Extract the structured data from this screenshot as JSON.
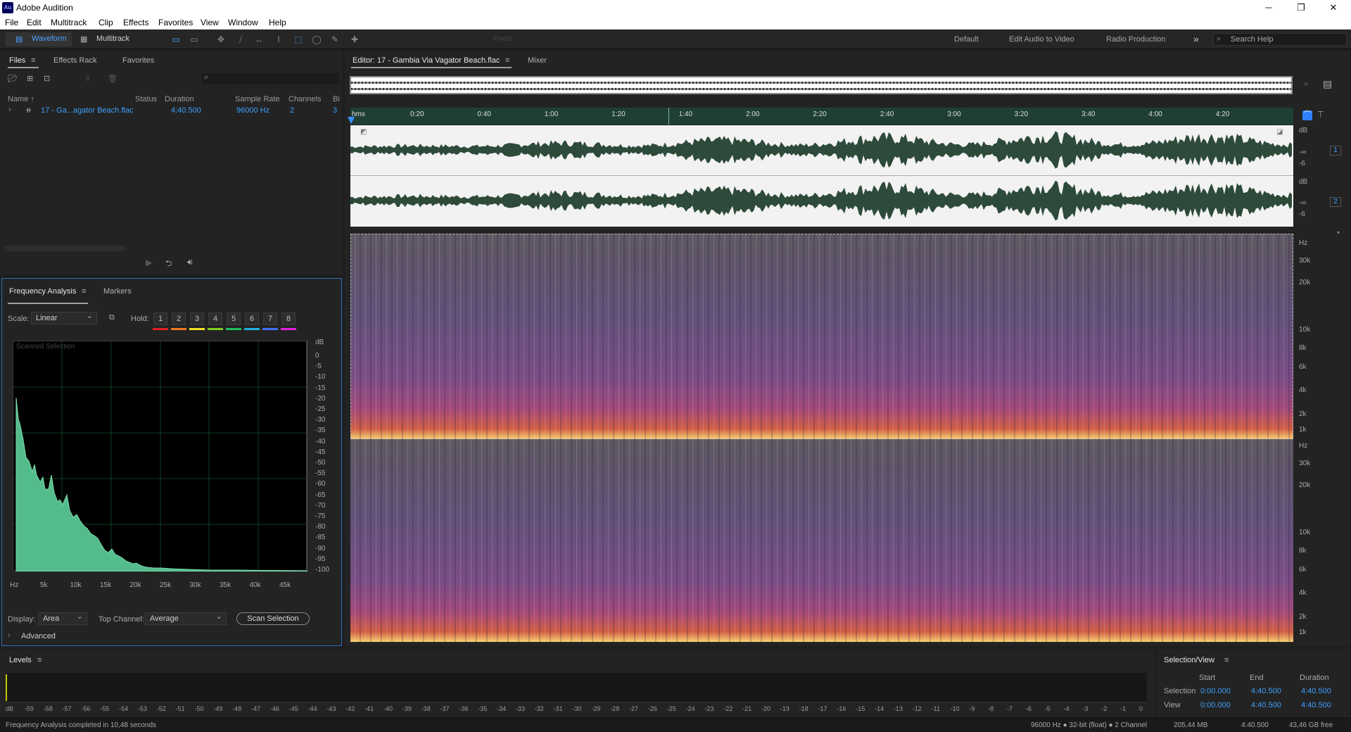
{
  "app": {
    "title": "Adobe Audition",
    "logo": "Au",
    "min": "─",
    "max": "❐",
    "close": "✕"
  },
  "menu": [
    "File",
    "Edit",
    "Multitrack",
    "Clip",
    "Effects",
    "Favorites",
    "View",
    "Window",
    "Help"
  ],
  "toolbar": {
    "waveform": "Waveform",
    "multitrack": "Multitrack",
    "invert": "Invert",
    "ws": [
      "Default",
      "Edit Audio to Video",
      "Radio Production"
    ],
    "more": "»",
    "search_placeholder": "Search Help"
  },
  "files": {
    "tabs": [
      "Files",
      "Effects Rack",
      "Favorites"
    ],
    "cols": [
      "Name ↑",
      "Status",
      "Duration",
      "Sample Rate",
      "Channels",
      "Bi"
    ],
    "row": {
      "name": "17 - Ga...agator Beach.flac",
      "duration": "4:40.500",
      "rate": "96000 Hz",
      "channels": "2",
      "bits": "3"
    }
  },
  "fa": {
    "tabs": [
      "Frequency Analysis",
      "Markers"
    ],
    "scale_label": "Scale:",
    "scale": "Linear",
    "hold_label": "Hold:",
    "hold": [
      "1",
      "2",
      "3",
      "4",
      "5",
      "6",
      "7",
      "8"
    ],
    "hold_colors": [
      "#e02020",
      "#f07820",
      "#f0e020",
      "#80d020",
      "#20c060",
      "#20b0e0",
      "#4070ff",
      "#e020e0"
    ],
    "scanned": "Scanned Selection",
    "db_ticks": [
      "dB",
      "0",
      "-5",
      "-10",
      "-15",
      "-20",
      "-25",
      "-30",
      "-35",
      "-40",
      "-45",
      "-50",
      "-55",
      "-60",
      "-65",
      "-70",
      "-75",
      "-80",
      "-85",
      "-90",
      "-95",
      "-100"
    ],
    "hz_ticks": [
      "Hz",
      "5k",
      "10k",
      "15k",
      "20k",
      "25k",
      "30k",
      "35k",
      "40k",
      "45k"
    ],
    "display_label": "Display:",
    "display": "Area",
    "top_channel_label": "Top Channel:",
    "top_channel": "Average",
    "scan_btn": "Scan Selection",
    "advanced": "Advanced"
  },
  "editor": {
    "tab": "Editor: 17 - Gambia Via Vagator Beach.flac",
    "mixer": "Mixer",
    "ruler": [
      "hms",
      "0:20",
      "0:40",
      "1:00",
      "1:20",
      "1:40",
      "2:00",
      "2:20",
      "2:40",
      "3:00",
      "3:20",
      "3:40",
      "4:00",
      "4:20"
    ],
    "wave_scale": [
      "dB",
      "-∞",
      "-6"
    ],
    "ch": [
      "1",
      "2"
    ],
    "spec_top": [
      "Hz",
      "30k",
      "20k",
      "10k",
      "8k",
      "6k",
      "4k",
      "2k",
      "1k"
    ]
  },
  "levels": {
    "title": "Levels",
    "ticks": [
      "dB",
      "-59",
      "-58",
      "-57",
      "-56",
      "-55",
      "-54",
      "-53",
      "-52",
      "-51",
      "-50",
      "-49",
      "-48",
      "-47",
      "-46",
      "-45",
      "-44",
      "-43",
      "-42",
      "-41",
      "-40",
      "-39",
      "-38",
      "-37",
      "-36",
      "-35",
      "-34",
      "-33",
      "-32",
      "-31",
      "-30",
      "-29",
      "-28",
      "-27",
      "-26",
      "-25",
      "-24",
      "-23",
      "-22",
      "-21",
      "-20",
      "-19",
      "-18",
      "-17",
      "-16",
      "-15",
      "-14",
      "-13",
      "-12",
      "-11",
      "-10",
      "-9",
      "-8",
      "-7",
      "-6",
      "-5",
      "-4",
      "-3",
      "-2",
      "-1",
      "0"
    ]
  },
  "selview": {
    "title": "Selection/View",
    "hdr": [
      "Start",
      "End",
      "Duration"
    ],
    "sel": [
      "Selection",
      "0:00.000",
      "4:40.500",
      "4:40.500"
    ],
    "view": [
      "View",
      "0:00.000",
      "4:40.500",
      "4:40.500"
    ]
  },
  "status": {
    "left": "Frequency Analysis completed in 10,48 seconds",
    "fmt": "96000 Hz ● 32-bit (float) ● 2 Channel",
    "size": "205,44 MB",
    "dur": "4:40.500",
    "free": "43,46 GB free"
  }
}
